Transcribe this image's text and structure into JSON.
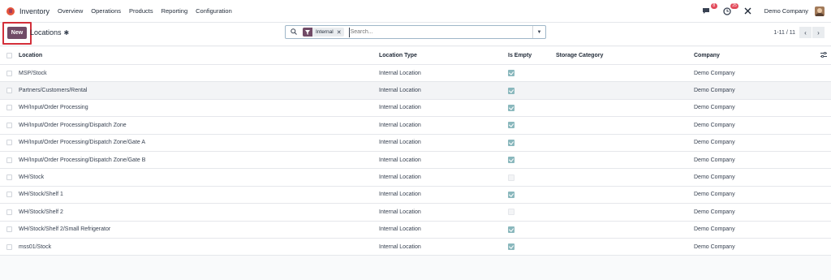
{
  "app": {
    "name": "Inventory"
  },
  "menu": [
    "Overview",
    "Operations",
    "Products",
    "Reporting",
    "Configuration"
  ],
  "systray": {
    "messages_count": "8",
    "activities_count": "25",
    "company": "Demo Company"
  },
  "control": {
    "new_label": "New",
    "breadcrumb": "Locations",
    "search": {
      "facet": "Internal",
      "placeholder": "Search..."
    },
    "pager": "1-11 / 11"
  },
  "table": {
    "columns": [
      "Location",
      "Location Type",
      "Is Empty",
      "Storage Category",
      "Company"
    ],
    "rows": [
      {
        "location": "MSP/Stock",
        "type": "Internal Location",
        "empty": true,
        "category": "",
        "company": "Demo Company"
      },
      {
        "location": "Partners/Customers/Rental",
        "type": "Internal Location",
        "empty": true,
        "category": "",
        "company": "Demo Company"
      },
      {
        "location": "WH/Input/Order Processing",
        "type": "Internal Location",
        "empty": true,
        "category": "",
        "company": "Demo Company"
      },
      {
        "location": "WH/Input/Order Processing/Dispatch Zone",
        "type": "Internal Location",
        "empty": true,
        "category": "",
        "company": "Demo Company"
      },
      {
        "location": "WH/Input/Order Processing/Dispatch Zone/Gate A",
        "type": "Internal Location",
        "empty": true,
        "category": "",
        "company": "Demo Company"
      },
      {
        "location": "WH/Input/Order Processing/Dispatch Zone/Gate B",
        "type": "Internal Location",
        "empty": true,
        "category": "",
        "company": "Demo Company"
      },
      {
        "location": "WH/Stock",
        "type": "Internal Location",
        "empty": false,
        "category": "",
        "company": "Demo Company"
      },
      {
        "location": "WH/Stock/Shelf 1",
        "type": "Internal Location",
        "empty": true,
        "category": "",
        "company": "Demo Company"
      },
      {
        "location": "WH/Stock/Shelf 2",
        "type": "Internal Location",
        "empty": false,
        "category": "",
        "company": "Demo Company"
      },
      {
        "location": "WH/Stock/Shelf 2/Small Refrigerator",
        "type": "Internal Location",
        "empty": true,
        "category": "",
        "company": "Demo Company"
      },
      {
        "location": "mss01/Stock",
        "type": "Internal Location",
        "empty": true,
        "category": "",
        "company": "Demo Company"
      }
    ]
  },
  "colors": {
    "brand": "#714b67",
    "highlight": "#d32f3a",
    "checkbox_on": "#8ab8bd",
    "badge": "#e24b5b"
  },
  "icons": [
    "app-logo-icon",
    "chat-icon",
    "clock-icon",
    "tools-icon",
    "gear-icon",
    "search-icon",
    "filter-icon",
    "close-icon",
    "caret-down-icon",
    "chevron-left-icon",
    "chevron-right-icon",
    "column-settings-icon"
  ]
}
